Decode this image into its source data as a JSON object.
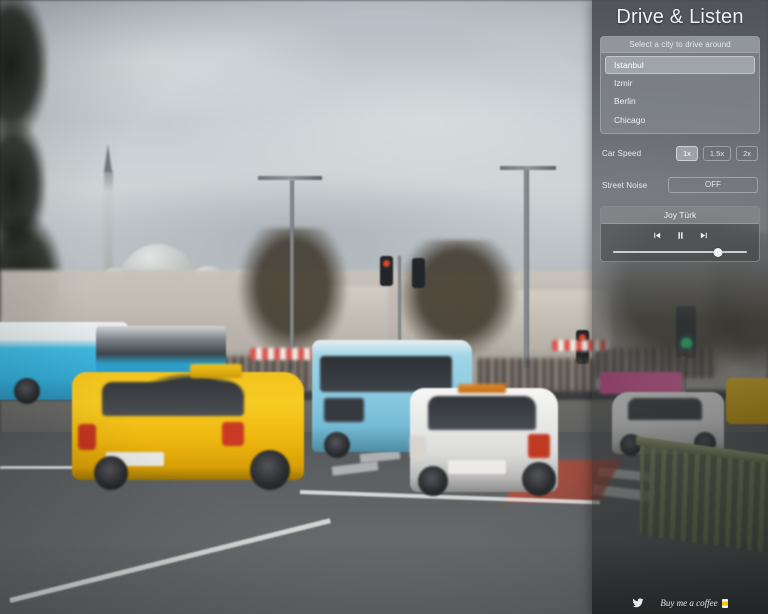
{
  "app": {
    "title": "Drive & Listen"
  },
  "city_selector": {
    "header": "Select a city to drive around",
    "items": [
      {
        "label": "Istanbul",
        "selected": true
      },
      {
        "label": "Izmir",
        "selected": false
      },
      {
        "label": "Berlin",
        "selected": false
      },
      {
        "label": "Chicago",
        "selected": false
      }
    ]
  },
  "car_speed": {
    "label": "Car Speed",
    "options": [
      {
        "label": "1x",
        "active": true
      },
      {
        "label": "1.5x",
        "active": false
      },
      {
        "label": "2x",
        "active": false
      }
    ]
  },
  "street_noise": {
    "label": "Street Noise",
    "state": "OFF"
  },
  "radio": {
    "station": "Joy Türk",
    "prev_icon": "⏮",
    "pause_icon": "⏸",
    "next_icon": "⏭",
    "volume_percent": 78
  },
  "footer": {
    "twitter_icon": "twitter-bird",
    "coffee_label": "Buy me a coffee",
    "coffee_icon": "coffee-cup"
  },
  "video": {
    "scene": "Istanbul street view — cloudy sky, mosque with minaret and domes, blue city buses, yellow taxi, light-blue minibus, white SUV, pedestrians, traffic lights, green pedestrian barrier"
  },
  "colors": {
    "panel_accent": "#a6aaae",
    "title_text": "#eef1f3",
    "taxi_yellow": "#f2c21c",
    "bus_blue": "#35a8d2",
    "minibus_blue": "#8ecbe2",
    "traffic_green": "#25d07a",
    "fence_green": "#808662"
  }
}
